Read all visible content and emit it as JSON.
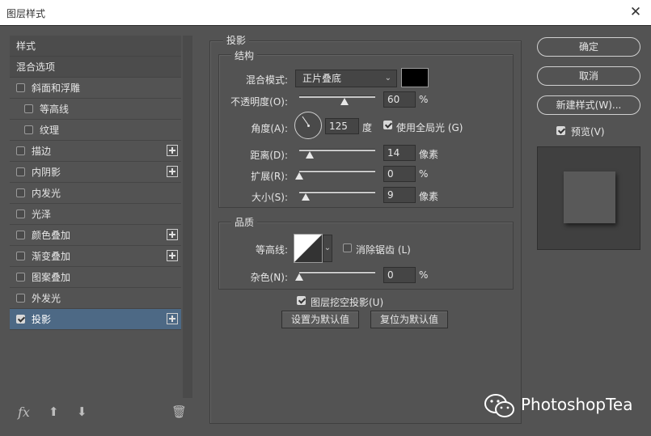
{
  "window": {
    "title": "图层样式"
  },
  "sidebar": {
    "items": [
      {
        "label": "样式",
        "type": "header",
        "checked": false,
        "plus": false
      },
      {
        "label": "混合选项",
        "type": "header",
        "checked": false,
        "plus": false
      },
      {
        "label": "斜面和浮雕",
        "type": "item",
        "checked": false,
        "plus": false
      },
      {
        "label": "等高线",
        "type": "sub",
        "checked": false,
        "plus": false
      },
      {
        "label": "纹理",
        "type": "sub",
        "checked": false,
        "plus": false
      },
      {
        "label": "描边",
        "type": "item",
        "checked": false,
        "plus": true
      },
      {
        "label": "内阴影",
        "type": "item",
        "checked": false,
        "plus": true
      },
      {
        "label": "内发光",
        "type": "item",
        "checked": false,
        "plus": false
      },
      {
        "label": "光泽",
        "type": "item",
        "checked": false,
        "plus": false
      },
      {
        "label": "颜色叠加",
        "type": "item",
        "checked": false,
        "plus": true
      },
      {
        "label": "渐变叠加",
        "type": "item",
        "checked": false,
        "plus": true
      },
      {
        "label": "图案叠加",
        "type": "item",
        "checked": false,
        "plus": false
      },
      {
        "label": "外发光",
        "type": "item",
        "checked": false,
        "plus": false
      },
      {
        "label": "投影",
        "type": "item",
        "checked": true,
        "plus": true,
        "active": true
      }
    ],
    "bottom": {
      "fx": "fx",
      "up": "⬆",
      "down": "⬇",
      "trash": "🗑"
    }
  },
  "shadow": {
    "section_title": "投影",
    "structure": {
      "title": "结构",
      "blend_mode": {
        "label": "混合模式:",
        "value": "正片叠底",
        "arrow": "⌄",
        "color": "#000000"
      },
      "opacity": {
        "label": "不透明度(O):",
        "value": "60",
        "unit": "%",
        "level": 60
      },
      "angle": {
        "label": "角度(A):",
        "value": "125",
        "unit": "度",
        "degrees": 125
      },
      "global_light": {
        "label": "使用全局光 (G)",
        "checked": true
      },
      "distance": {
        "label": "距离(D):",
        "value": "14",
        "unit": "像素",
        "level": 14
      },
      "spread": {
        "label": "扩展(R):",
        "value": "0",
        "unit": "%",
        "level": 0
      },
      "size": {
        "label": "大小(S):",
        "value": "9",
        "unit": "像素",
        "level": 9
      }
    },
    "quality": {
      "title": "品质",
      "contour": {
        "label": "等高线:",
        "arrow": "⌄"
      },
      "anti_alias": {
        "label": "消除锯齿 (L)",
        "checked": false
      },
      "noise": {
        "label": "杂色(N):",
        "value": "0",
        "unit": "%",
        "level": 0
      }
    },
    "knockout": {
      "label": "图层挖空投影(U)",
      "checked": true
    },
    "set_default": "设置为默认值",
    "reset_default": "复位为默认值"
  },
  "actions": {
    "ok": "确定",
    "cancel": "取消",
    "new_style": "新建样式(W)...",
    "preview": {
      "label": "预览(V)",
      "checked": true
    }
  },
  "watermark": {
    "text": "PhotoshopTea"
  }
}
